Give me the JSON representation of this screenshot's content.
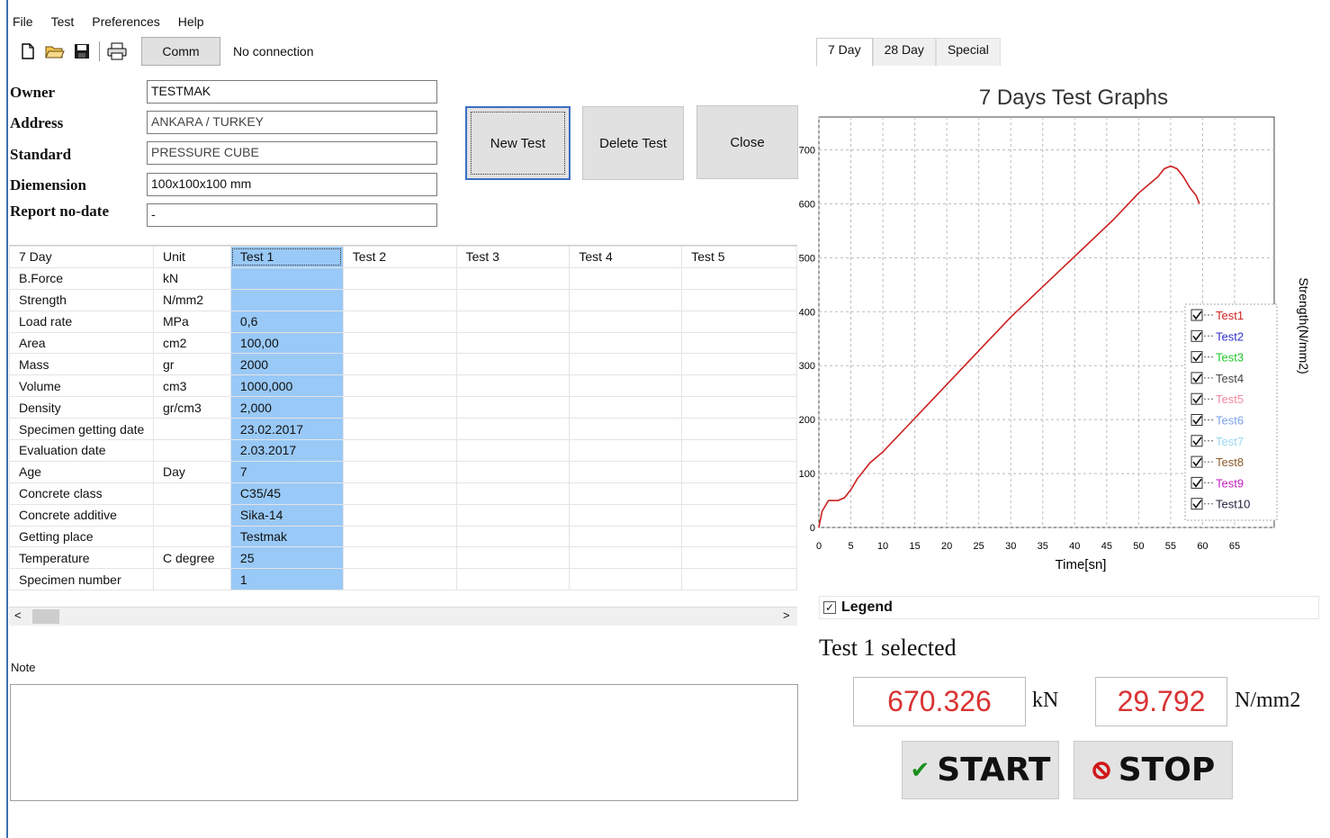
{
  "menu": [
    "File",
    "Test",
    "Preferences",
    "Help"
  ],
  "toolbar": {
    "icons": [
      "new-file-icon",
      "open-folder-icon",
      "save-icon",
      "print-icon"
    ],
    "comm_label": "Comm",
    "status": "No connection"
  },
  "form": {
    "owner_label": "Owner",
    "owner_value": "TESTMAK",
    "address_label": "Address",
    "address_value": "ANKARA / TURKEY",
    "standard_label": "Standard",
    "standard_value": "PRESSURE CUBE",
    "dimension_label": "Diemension",
    "dimension_value": "100x100x100 mm",
    "report_label": "Report no-date",
    "report_value": "-"
  },
  "buttons": {
    "new_test": "New Test",
    "delete_test": "Delete Test",
    "close": "Close"
  },
  "grid": {
    "headers": [
      "7 Day",
      "Unit",
      "Test 1",
      "Test 2",
      "Test 3",
      "Test 4",
      "Test 5"
    ],
    "rows": [
      [
        "B.Force",
        "kN",
        ""
      ],
      [
        "Strength",
        "N/mm2",
        ""
      ],
      [
        "Load rate",
        "MPa",
        "0,6"
      ],
      [
        "Area",
        "cm2",
        "100,00"
      ],
      [
        "Mass",
        "gr",
        "2000"
      ],
      [
        "Volume",
        "cm3",
        "1000,000"
      ],
      [
        "Density",
        "gr/cm3",
        "2,000"
      ],
      [
        "Specimen getting date",
        "",
        "23.02.2017"
      ],
      [
        "Evaluation date",
        "",
        "2.03.2017"
      ],
      [
        "Age",
        "Day",
        "7"
      ],
      [
        "Concrete class",
        "",
        "C35/45"
      ],
      [
        "Concrete additive",
        "",
        "Sika-14"
      ],
      [
        "Getting place",
        "",
        "Testmak"
      ],
      [
        "Temperature",
        "C degree",
        "25"
      ],
      [
        "Specimen number",
        "",
        "1"
      ]
    ]
  },
  "note_label": "Note",
  "tabs": [
    "7 Day",
    "28 Day",
    "Special"
  ],
  "chart_data": {
    "type": "line",
    "title": "7 Days Test Graphs",
    "xlabel": "Time[sn]",
    "ylabel": "Strength(N/mm2)",
    "xlim": [
      0,
      65
    ],
    "ylim": [
      0,
      700
    ],
    "xticks": [
      0,
      5,
      10,
      15,
      20,
      25,
      30,
      35,
      40,
      45,
      50,
      55,
      60,
      65
    ],
    "yticks": [
      0,
      100,
      200,
      300,
      400,
      500,
      600,
      700
    ],
    "grid": true,
    "legend_position": "right",
    "series": [
      {
        "name": "Test1",
        "color": "#cc2020",
        "x": [
          0,
          0.5,
          1.5,
          3,
          4,
          5,
          6,
          8,
          10,
          14,
          18,
          22,
          26,
          30,
          34,
          38,
          42,
          46,
          50,
          53,
          54,
          55,
          56,
          57,
          58,
          59,
          59.5
        ],
        "y": [
          0,
          30,
          50,
          50,
          55,
          70,
          90,
          120,
          140,
          190,
          240,
          290,
          340,
          390,
          435,
          480,
          525,
          570,
          620,
          650,
          665,
          670,
          665,
          650,
          630,
          615,
          600
        ]
      }
    ],
    "legend_entries": [
      {
        "name": "Test1",
        "color": "#d02424"
      },
      {
        "name": "Test2",
        "color": "#3030c8"
      },
      {
        "name": "Test3",
        "color": "#22c52a"
      },
      {
        "name": "Test4",
        "color": "#444444"
      },
      {
        "name": "Test5",
        "color": "#f08aa0"
      },
      {
        "name": "Test6",
        "color": "#7aa0e8"
      },
      {
        "name": "Test7",
        "color": "#9ad8f0"
      },
      {
        "name": "Test8",
        "color": "#8a5a2a"
      },
      {
        "name": "Test9",
        "color": "#c21fbf"
      },
      {
        "name": "Test10",
        "color": "#202040"
      }
    ]
  },
  "legend_toggle_label": "Legend",
  "selected_text": "Test 1 selected",
  "readouts": {
    "force_value": "670.326",
    "force_unit": "kN",
    "strength_value": "29.792",
    "strength_unit": "N/mm2"
  },
  "actions": {
    "start": "START",
    "stop": "STOP"
  }
}
